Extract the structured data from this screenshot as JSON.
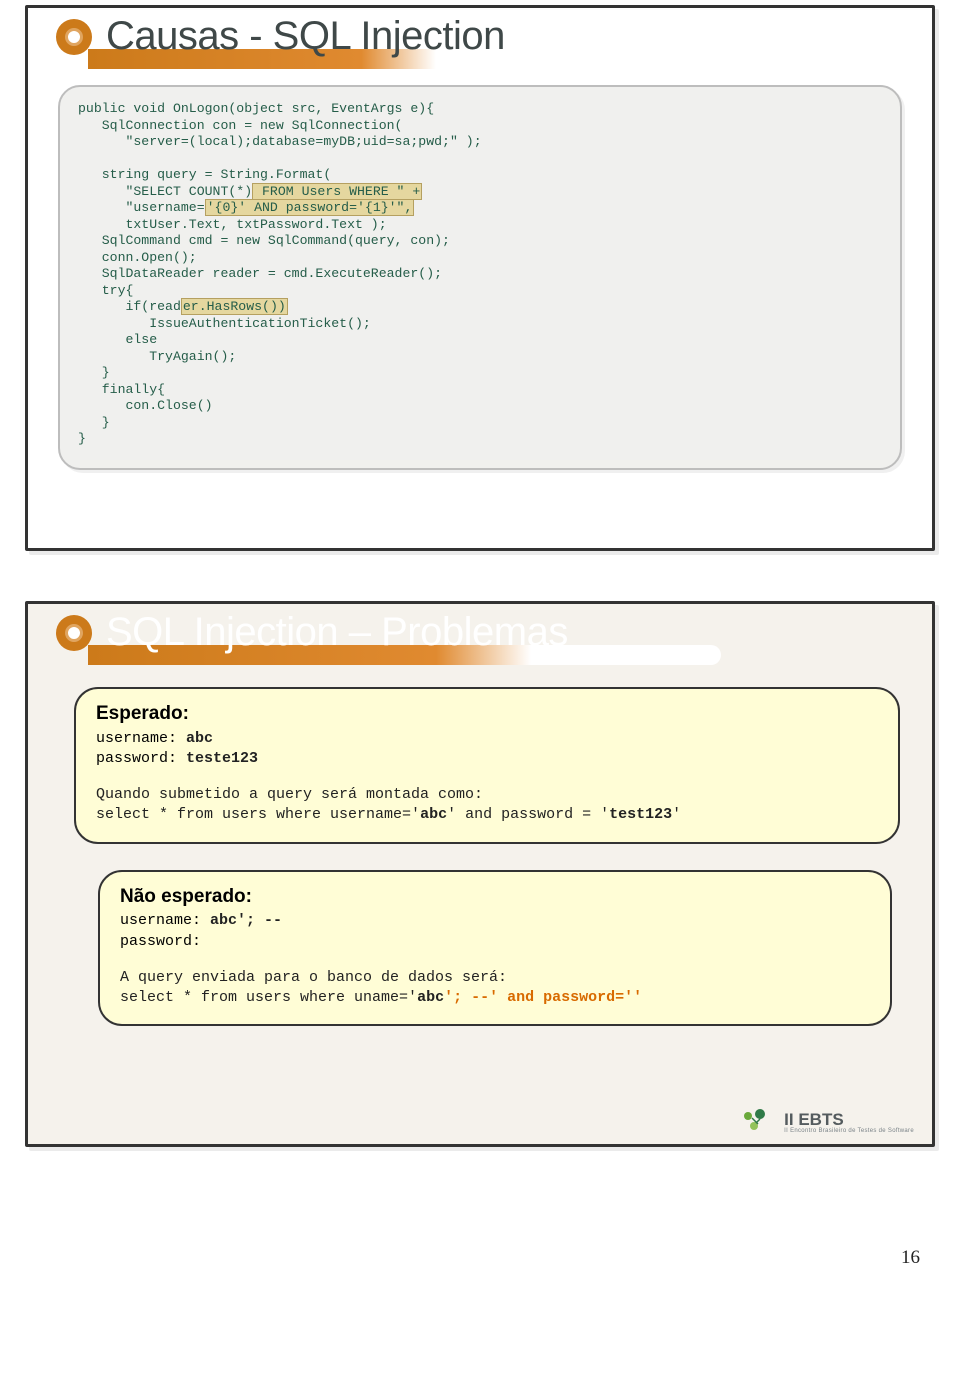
{
  "slide1": {
    "title": "Causas - SQL Injection",
    "code": {
      "l1": "public void OnLogon(object src, EventArgs e){",
      "l2": "   SqlConnection con = new SqlConnection(",
      "l3": "      \"server=(local);database=myDB;uid=sa;pwd;\" );",
      "l4": "   string query = String.Format(",
      "l5a": "      \"SELECT COUNT(*)",
      "l5b": " FROM Users WHERE \" +",
      "l6a": "      \"username=",
      "l6b": "'{0}' AND password='{1}'\",",
      "l7": "      txtUser.Text, txtPassword.Text );",
      "l8": "   SqlCommand cmd = new SqlCommand(query, con);",
      "l9": "   conn.Open();",
      "l10": "   SqlDataReader reader = cmd.ExecuteReader();",
      "l11": "   try{",
      "l12a": "      if(read",
      "l12b": "er.HasRows())",
      "l13": "         IssueAuthenticationTicket();",
      "l14": "      else",
      "l15": "         TryAgain();",
      "l16": "   }",
      "l17": "   finally{",
      "l18": "      con.Close()",
      "l19": "   }",
      "l20": "}"
    }
  },
  "slide2": {
    "title": "SQL Injection – Problemas",
    "expected": {
      "heading": "Esperado:",
      "user_label": "username: ",
      "user_value": "abc",
      "pass_label": "password: ",
      "pass_value": "teste123",
      "note": "Quando submetido a query será montada como:",
      "query_prefix": "select * from users where username='",
      "query_user": "abc",
      "query_mid": "' and password = '",
      "query_pass": "test123",
      "query_suffix": "'"
    },
    "unexpected": {
      "heading": "Não esperado:",
      "user_label": "username: ",
      "user_value": "abc'; --",
      "pass_label": "password:",
      "note": "A query enviada para o banco de dados será:",
      "query_prefix": "select * from users where uname='",
      "query_user": "abc",
      "query_suffix": "'; --' and password=''"
    },
    "logo": "II EBTS",
    "logo_sub": "II Encontro Brasileiro de Testes de Software"
  },
  "page_number": "16"
}
